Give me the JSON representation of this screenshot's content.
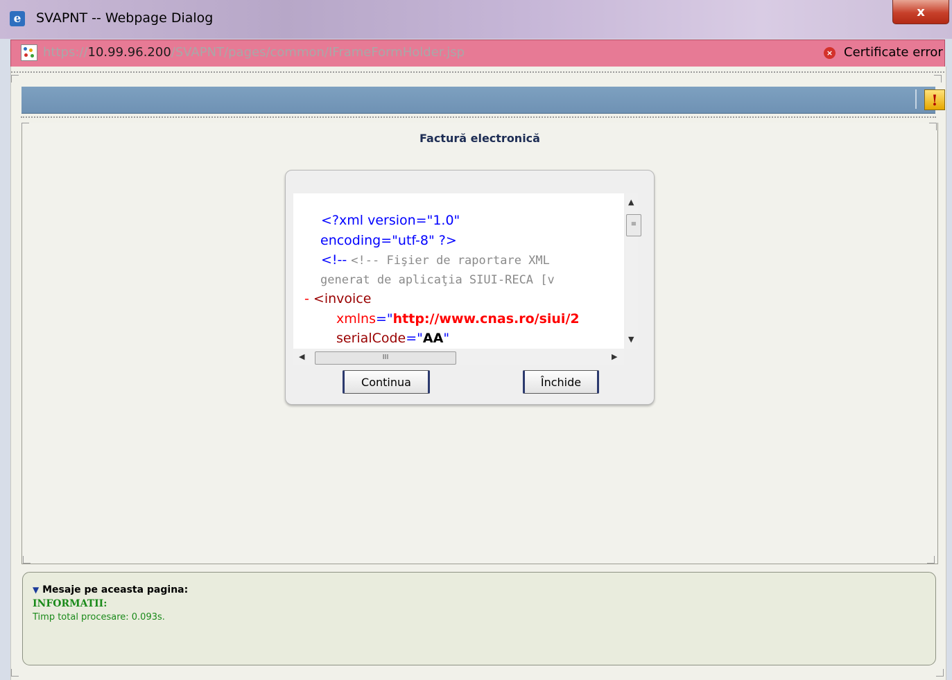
{
  "window": {
    "title": "SVAPNT -- Webpage Dialog",
    "close_label": "x"
  },
  "address": {
    "url_prefix": "https://",
    "url_host": "10.99.96.200",
    "url_path": "/SVAPNT/pages/common/IFrameFormHolder.jsp",
    "certificate_error": "Certificate error"
  },
  "toolbar": {
    "warning_icon": "!"
  },
  "page": {
    "title": "Factură electronică"
  },
  "xml_viewer": {
    "line1": "<?xml version=\"1.0\"",
    "line2": "encoding=\"utf-8\" ?>",
    "line3": "<!-- Fişier de raportare XML",
    "line4": "generat de aplicaţia SIUI-RECA [v",
    "collapse": "-",
    "line5": "<invoice",
    "attr1_name": "xmlns",
    "attr1_value": "http://www.cnas.ro/siui/2",
    "attr2_name": "serialCode",
    "attr2_value": "AA",
    "hscroll_grip": "III",
    "vscroll_grip": "≡"
  },
  "buttons": {
    "continue": "Continua",
    "close": "Închide"
  },
  "messages": {
    "header": "Mesaje pe aceasta pagina:",
    "category": "INFORMATII:",
    "line": "Timp total procesare: 0.093s."
  },
  "colors": {
    "address_bar": "#e77a95",
    "toolbar": "#7da0c0",
    "message_text": "#1a8a1a",
    "page_title": "#1d2d54"
  }
}
